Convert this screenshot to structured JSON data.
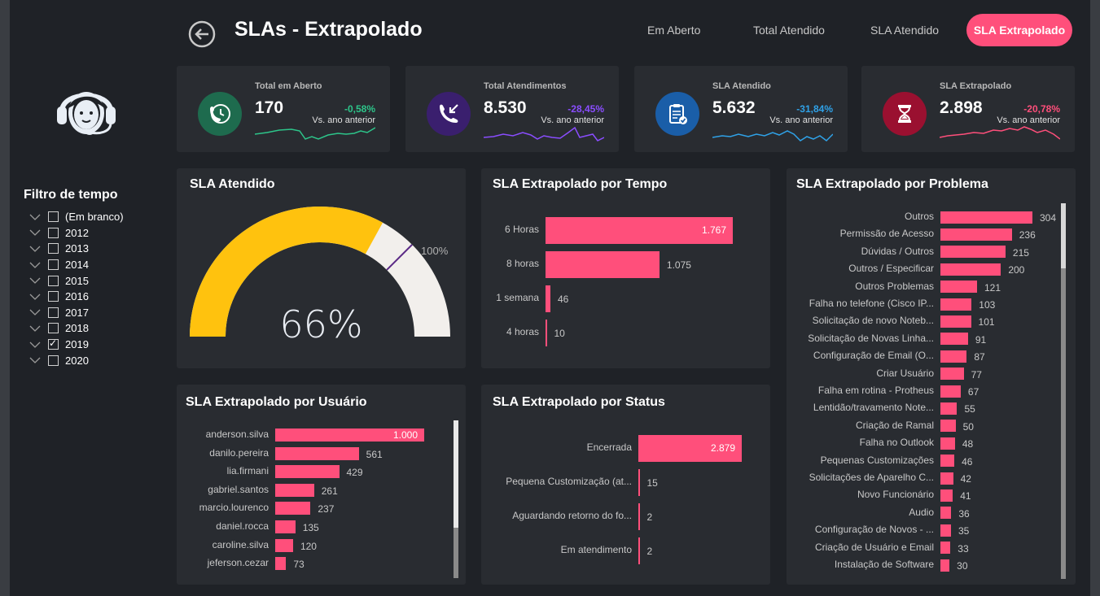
{
  "header": {
    "title": "SLAs - Extrapolado",
    "nav": [
      "Em Aberto",
      "Total Atendido",
      "SLA Atendido"
    ],
    "nav_active": "SLA Extrapolado"
  },
  "sidebar": {
    "filter_title": "Filtro de tempo",
    "filters": [
      {
        "label": "(Em branco)",
        "checked": false
      },
      {
        "label": "2012",
        "checked": false
      },
      {
        "label": "2013",
        "checked": false
      },
      {
        "label": "2014",
        "checked": false
      },
      {
        "label": "2015",
        "checked": false
      },
      {
        "label": "2016",
        "checked": false
      },
      {
        "label": "2017",
        "checked": false
      },
      {
        "label": "2018",
        "checked": false
      },
      {
        "label": "2019",
        "checked": true
      },
      {
        "label": "2020",
        "checked": false
      }
    ]
  },
  "kpis": [
    {
      "label": "Total em Aberto",
      "value": "170",
      "delta": "-0,58%",
      "sub": "Vs. ano anterior",
      "color": "#2dc58a",
      "icon_bg": "#1e6b4e",
      "icon": "phone-clock-icon"
    },
    {
      "label": "Total Atendimentos",
      "value": "8.530",
      "delta": "-28,45%",
      "sub": "Vs. ano anterior",
      "color": "#8a4dff",
      "icon_bg": "#3a1f6e",
      "icon": "phone-incoming-icon"
    },
    {
      "label": "SLA Atendido",
      "value": "5.632",
      "delta": "-31,84%",
      "sub": "Vs. ano anterior",
      "color": "#2fa2e8",
      "icon_bg": "#1a5ea8",
      "icon": "clipboard-check-icon"
    },
    {
      "label": "SLA Extrapolado",
      "value": "2.898",
      "delta": "-20,78%",
      "sub": "Vs. ano anterior",
      "color": "#ff4f7b",
      "icon_bg": "#9a1030",
      "icon": "hourglass-icon"
    }
  ],
  "gauge": {
    "title": "SLA Atendido",
    "value_label": "66%",
    "target_label": "100%",
    "value": 0.66,
    "fill_color": "#ffc20e",
    "track_color": "#f2efec"
  },
  "tempo": {
    "title": "SLA Extrapolado por Tempo",
    "categories": [
      "6 Horas",
      "8 horas",
      "1 semana",
      "4 horas"
    ],
    "values": [
      1767,
      1075,
      46,
      10
    ],
    "labels": [
      "1.767",
      "1.075",
      "46",
      "10"
    ]
  },
  "usuario": {
    "title": "SLA Extrapolado por Usuário",
    "categories": [
      "anderson.silva",
      "danilo.pereira",
      "lia.firmani",
      "gabriel.santos",
      "marcio.lourenco",
      "daniel.rocca",
      "caroline.silva",
      "jeferson.cezar"
    ],
    "values": [
      1000,
      561,
      429,
      261,
      237,
      135,
      120,
      73
    ],
    "labels": [
      "1.000",
      "561",
      "429",
      "261",
      "237",
      "135",
      "120",
      "73"
    ]
  },
  "status": {
    "title": "SLA Extrapolado por Status",
    "categories": [
      "Encerrada",
      "Pequena Customização (at...",
      "Aguardando retorno do fo...",
      "Em atendimento"
    ],
    "values": [
      2879,
      15,
      2,
      2
    ],
    "labels": [
      "2.879",
      "15",
      "2",
      "2"
    ]
  },
  "problema": {
    "title": "SLA Extrapolado por Problema",
    "categories": [
      "Outros",
      "Permissão de Acesso",
      "Dúvidas / Outros",
      "Outros / Especificar",
      "Outros Problemas",
      "Falha no telefone (Cisco IP...",
      "Solicitação de novo Noteb...",
      "Solicitação de Novas Linha...",
      "Configuração de Email (O...",
      "Criar Usuário",
      "Falha em rotina - Protheus",
      "Lentidão/travamento Note...",
      "Criação de Ramal",
      "Falha no Outlook",
      "Pequenas Customizações",
      "Solicitações de Aparelho C...",
      "Novo Funcionário",
      "Audio",
      "Configuração de Novos - ...",
      "Criação de Usuário e Email",
      "Instalação de Software"
    ],
    "values": [
      304,
      236,
      215,
      200,
      121,
      103,
      101,
      91,
      87,
      77,
      67,
      55,
      50,
      48,
      46,
      42,
      41,
      36,
      35,
      33,
      30
    ],
    "labels": [
      "304",
      "236",
      "215",
      "200",
      "121",
      "103",
      "101",
      "91",
      "87",
      "77",
      "67",
      "55",
      "50",
      "48",
      "46",
      "42",
      "41",
      "36",
      "35",
      "33",
      "30"
    ]
  },
  "chart_data": [
    {
      "type": "bar",
      "title": "SLA Extrapolado por Tempo",
      "categories": [
        "6 Horas",
        "8 horas",
        "1 semana",
        "4 horas"
      ],
      "values": [
        1767,
        1075,
        46,
        10
      ]
    },
    {
      "type": "bar",
      "title": "SLA Extrapolado por Usuário",
      "categories": [
        "anderson.silva",
        "danilo.pereira",
        "lia.firmani",
        "gabriel.santos",
        "marcio.lourenco",
        "daniel.rocca",
        "caroline.silva",
        "jeferson.cezar"
      ],
      "values": [
        1000,
        561,
        429,
        261,
        237,
        135,
        120,
        73
      ]
    },
    {
      "type": "bar",
      "title": "SLA Extrapolado por Status",
      "categories": [
        "Encerrada",
        "Pequena Customização (at...",
        "Aguardando retorno do fo...",
        "Em atendimento"
      ],
      "values": [
        2879,
        15,
        2,
        2
      ]
    },
    {
      "type": "bar",
      "title": "SLA Extrapolado por Problema",
      "categories": [
        "Outros",
        "Permissão de Acesso",
        "Dúvidas / Outros",
        "Outros / Especificar",
        "Outros Problemas",
        "Falha no telefone (Cisco IP...",
        "Solicitação de novo Noteb...",
        "Solicitação de Novas Linha...",
        "Configuração de Email (O...",
        "Criar Usuário",
        "Falha em rotina - Protheus",
        "Lentidão/travamento Note...",
        "Criação de Ramal",
        "Falha no Outlook",
        "Pequenas Customizações",
        "Solicitações de Aparelho C...",
        "Novo Funcionário",
        "Audio",
        "Configuração de Novos - ...",
        "Criação de Usuário e Email",
        "Instalação de Software"
      ],
      "values": [
        304,
        236,
        215,
        200,
        121,
        103,
        101,
        91,
        87,
        77,
        67,
        55,
        50,
        48,
        46,
        42,
        41,
        36,
        35,
        33,
        30
      ]
    }
  ]
}
